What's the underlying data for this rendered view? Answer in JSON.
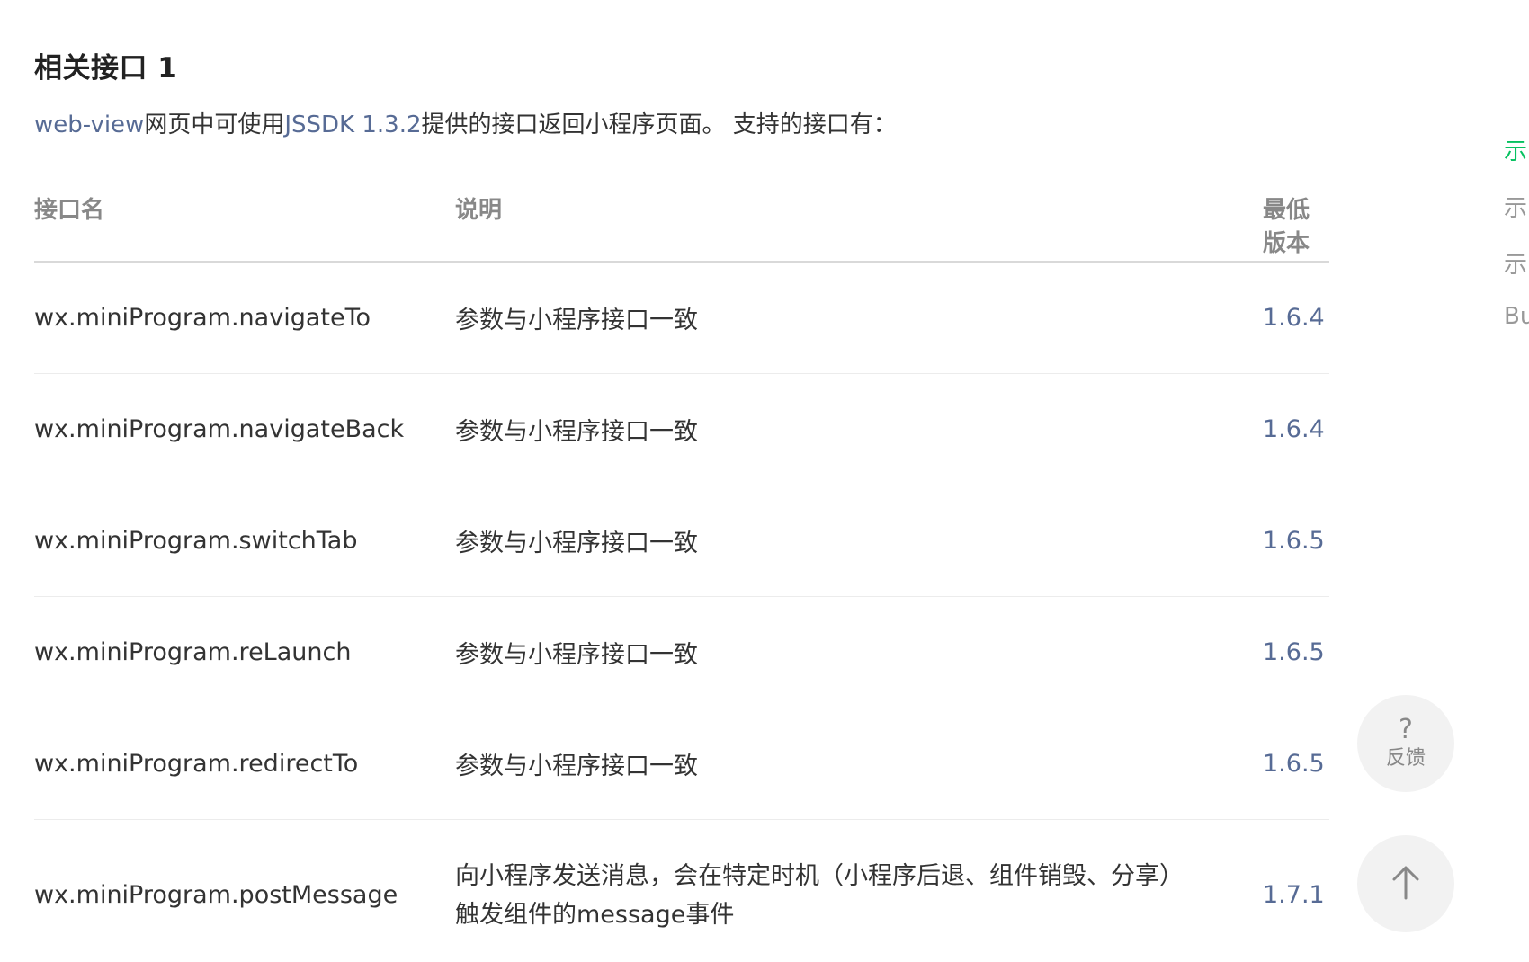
{
  "section": {
    "title": "相关接口 1",
    "intro_link1": "web-view",
    "intro_text1": "网页中可使用",
    "intro_link2": "JSSDK 1.3.2",
    "intro_text2": "提供的接口返回小程序页面。 支持的接口有："
  },
  "table": {
    "headers": {
      "name": "接口名",
      "desc": "说明",
      "version": "最低版本"
    },
    "rows": [
      {
        "name": "wx.miniProgram.navigateTo",
        "desc": "参数与小程序接口一致",
        "version": "1.6.4"
      },
      {
        "name": "wx.miniProgram.navigateBack",
        "desc": "参数与小程序接口一致",
        "version": "1.6.4"
      },
      {
        "name": "wx.miniProgram.switchTab",
        "desc": "参数与小程序接口一致",
        "version": "1.6.5"
      },
      {
        "name": "wx.miniProgram.reLaunch",
        "desc": "参数与小程序接口一致",
        "version": "1.6.5"
      },
      {
        "name": "wx.miniProgram.redirectTo",
        "desc": "参数与小程序接口一致",
        "version": "1.6.5"
      },
      {
        "name": "wx.miniProgram.postMessage",
        "desc": "向小程序发送消息，会在特定时机（小程序后退、组件销毁、分享）触发组件的message事件",
        "version": "1.7.1"
      }
    ]
  },
  "right_nav": {
    "items": [
      {
        "label": "示",
        "active": true
      },
      {
        "label": "示",
        "active": false
      },
      {
        "label": "示",
        "active": false
      },
      {
        "label": "Bu",
        "active": false
      }
    ]
  },
  "floating": {
    "feedback_icon": "?",
    "feedback_label": "反馈",
    "top_icon": "arrow-up-icon"
  },
  "colors": {
    "link": "#576b95",
    "active_nav": "#07c160"
  }
}
